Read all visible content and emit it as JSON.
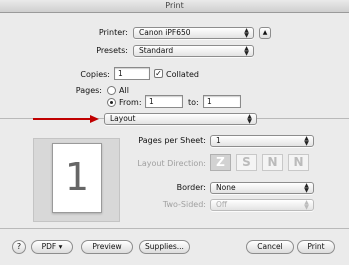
{
  "window": {
    "title": "Print"
  },
  "printer": {
    "label": "Printer:",
    "value": "Canon iPF650"
  },
  "presets": {
    "label": "Presets:",
    "value": "Standard"
  },
  "copies": {
    "label": "Copies:",
    "value": "1",
    "collated_label": "Collated",
    "collated_checked": true
  },
  "pages": {
    "label": "Pages:",
    "all_label": "All",
    "from_label": "From:",
    "from_value": "1",
    "to_label": "to:",
    "to_value": "1"
  },
  "section": {
    "value": "Layout"
  },
  "layout": {
    "pages_per_sheet_label": "Pages per Sheet:",
    "pages_per_sheet_value": "1",
    "layout_direction_label": "Layout Direction:",
    "directions": [
      "Z",
      "S",
      "N",
      "N"
    ],
    "border_label": "Border:",
    "border_value": "None",
    "two_sided_label": "Two-Sided:",
    "two_sided_value": "Off"
  },
  "preview": {
    "page_number": "1"
  },
  "footer": {
    "help": "?",
    "pdf": "PDF ▾",
    "preview": "Preview",
    "supplies": "Supplies...",
    "cancel": "Cancel",
    "print": "Print"
  },
  "colors": {
    "annotation_arrow": "#c00000"
  }
}
